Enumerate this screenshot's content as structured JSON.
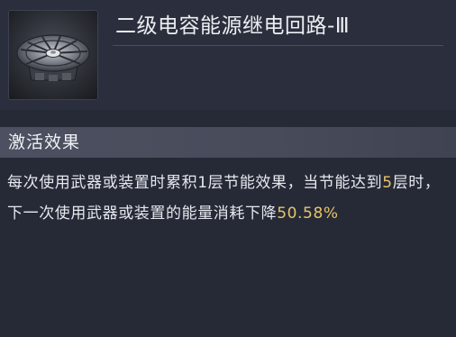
{
  "item": {
    "name": "二级电容能源继电回路-Ⅲ",
    "image_icon": "drone-relay-module-icon"
  },
  "section": {
    "title": "激活效果"
  },
  "description": {
    "part1": "每次使用武器或装置时累积1层节能效果，当节能达到",
    "highlight1": "5",
    "part2": "层时，下一次使用武器或装置的能量消耗下降",
    "highlight2": "50.58%"
  },
  "colors": {
    "background": "#262a37",
    "section_band": "#4c5060",
    "highlight": "#e8c46a",
    "text": "#e6e8ee"
  }
}
